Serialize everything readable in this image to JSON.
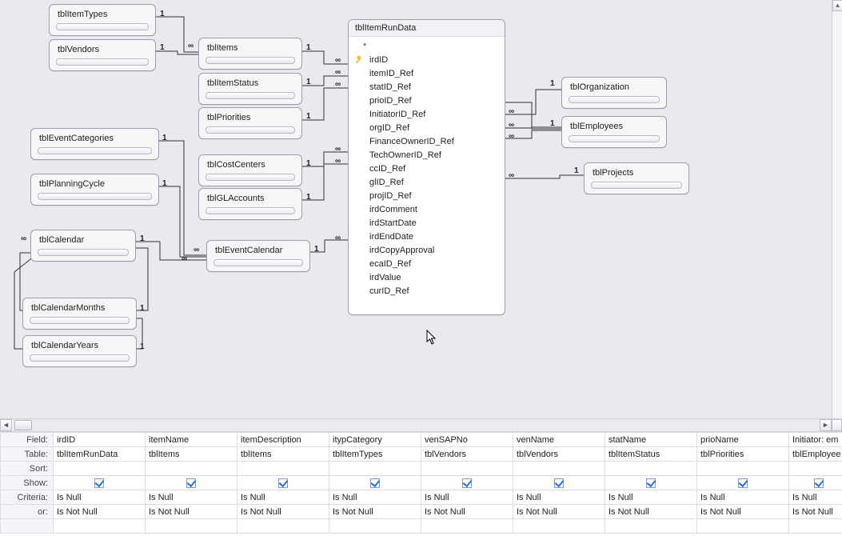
{
  "diagram": {
    "tables": {
      "tblItemTypes": "tblItemTypes",
      "tblVendors": "tblVendors",
      "tblItems": "tblItems",
      "tblItemStatus": "tblItemStatus",
      "tblPriorities": "tblPriorities",
      "tblEventCategories": "tblEventCategories",
      "tblCostCenters": "tblCostCenters",
      "tblPlanningCycle": "tblPlanningCycle",
      "tblGLAccounts": "tblGLAccounts",
      "tblCalendar": "tblCalendar",
      "tblEventCalendar": "tblEventCalendar",
      "tblCalendarMonths": "tblCalendarMonths",
      "tblCalendarYears": "tblCalendarYears",
      "tblOrganization": "tblOrganization",
      "tblEmployees": "tblEmployees",
      "tblProjects": "tblProjects"
    },
    "main": {
      "title": "tblItemRunData",
      "fields": [
        {
          "name": "*",
          "key": false,
          "star": true
        },
        {
          "name": "irdID",
          "key": true
        },
        {
          "name": "itemID_Ref",
          "key": false
        },
        {
          "name": "statID_Ref",
          "key": false
        },
        {
          "name": "prioID_Ref",
          "key": false
        },
        {
          "name": "InitiatorID_Ref",
          "key": false
        },
        {
          "name": "orgID_Ref",
          "key": false
        },
        {
          "name": "FinanceOwnerID_Ref",
          "key": false
        },
        {
          "name": "TechOwnerID_Ref",
          "key": false
        },
        {
          "name": "ccID_Ref",
          "key": false
        },
        {
          "name": "glID_Ref",
          "key": false
        },
        {
          "name": "projID_Ref",
          "key": false
        },
        {
          "name": "irdComment",
          "key": false
        },
        {
          "name": "irdStartDate",
          "key": false
        },
        {
          "name": "irdEndDate",
          "key": false
        },
        {
          "name": "irdCopyApproval",
          "key": false
        },
        {
          "name": "ecaID_Ref",
          "key": false
        },
        {
          "name": "irdValue",
          "key": false
        },
        {
          "name": "curID_Ref",
          "key": false
        }
      ]
    },
    "card_one": "1",
    "card_many": "∞"
  },
  "grid": {
    "rowLabels": {
      "field": "Field:",
      "table": "Table:",
      "sort": "Sort:",
      "show": "Show:",
      "criteria": "Criteria:",
      "or": "or:"
    },
    "columns": [
      {
        "field": "irdID",
        "table": "tblItemRunData",
        "show": true,
        "criteria": "Is Null",
        "or": "Is Not Null"
      },
      {
        "field": "itemName",
        "table": "tblItems",
        "show": true,
        "criteria": "Is Null",
        "or": "Is Not Null"
      },
      {
        "field": "itemDescription",
        "table": "tblItems",
        "show": true,
        "criteria": "Is Null",
        "or": "Is Not Null"
      },
      {
        "field": "itypCategory",
        "table": "tblItemTypes",
        "show": true,
        "criteria": "Is Null",
        "or": "Is Not Null"
      },
      {
        "field": "venSAPNo",
        "table": "tblVendors",
        "show": true,
        "criteria": "Is Null",
        "or": "Is Not Null"
      },
      {
        "field": "venName",
        "table": "tblVendors",
        "show": true,
        "criteria": "Is Null",
        "or": "Is Not Null"
      },
      {
        "field": "statName",
        "table": "tblItemStatus",
        "show": true,
        "criteria": "Is Null",
        "or": "Is Not Null"
      },
      {
        "field": "prioName",
        "table": "tblPriorities",
        "show": true,
        "criteria": "Is Null",
        "or": "Is Not Null"
      },
      {
        "field": "Initiator: em",
        "table": "tblEmployee",
        "show": true,
        "criteria": "Is Null",
        "or": "Is Not Null"
      }
    ]
  }
}
